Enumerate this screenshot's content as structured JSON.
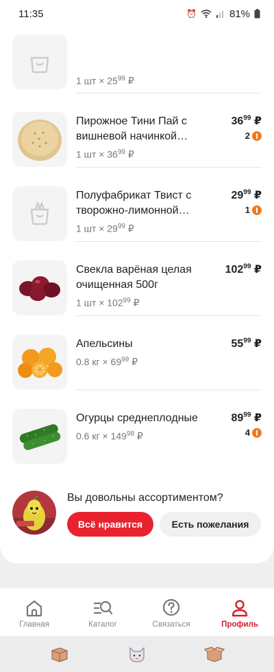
{
  "status": {
    "time": "11:35",
    "battery": "81%",
    "icons": [
      "alarm-icon",
      "wifi-icon",
      "signal-icon",
      "battery-icon"
    ]
  },
  "header": {
    "back_icon": "arrow-left-icon"
  },
  "items": [
    {
      "name": "",
      "qty_prefix": "1 шт × 25",
      "qty_kop": "99",
      "qty_suffix": " ₽",
      "price": "",
      "price_kop": "",
      "bonus": "",
      "thumb": "placeholder-bag"
    },
    {
      "name": "Пирожное Тини Пай с вишневой начинкой…",
      "qty_prefix": "1 шт × 36",
      "qty_kop": "99",
      "qty_suffix": " ₽",
      "price": "36",
      "price_kop": "99",
      "currency": " ₽",
      "bonus": "2",
      "thumb": "pie"
    },
    {
      "name": "Полуфабрикат Твист с творожно-лимонной…",
      "qty_prefix": "1 шт × 29",
      "qty_kop": "99",
      "qty_suffix": " ₽",
      "price": "29",
      "price_kop": "99",
      "currency": " ₽",
      "bonus": "1",
      "thumb": "placeholder-bag"
    },
    {
      "name": "Свекла варёная целая очищенная 500г",
      "qty_prefix": "1 шт × 102",
      "qty_kop": "99",
      "qty_suffix": " ₽",
      "price": "102",
      "price_kop": "99",
      "currency": " ₽",
      "bonus": "",
      "thumb": "beets"
    },
    {
      "name": "Апельсины",
      "qty_prefix": "0.8 кг × 69",
      "qty_kop": "99",
      "qty_suffix": " ₽",
      "price": "55",
      "price_kop": "99",
      "currency": " ₽",
      "bonus": "",
      "thumb": "oranges"
    },
    {
      "name": "Огурцы среднеплодные",
      "qty_prefix": "0.6 кг × 149",
      "qty_kop": "98",
      "qty_suffix": " ₽",
      "price": "89",
      "price_kop": "99",
      "currency": " ₽",
      "bonus": "4",
      "thumb": "cucumbers"
    }
  ],
  "survey": {
    "question": "Вы довольны ассортиментом?",
    "like_label": "Всё нравится",
    "wish_label": "Есть пожелания"
  },
  "tabs": [
    {
      "label": "Главная",
      "icon": "home-icon",
      "active": false
    },
    {
      "label": "Каталог",
      "icon": "catalog-search-icon",
      "active": false
    },
    {
      "label": "Связаться",
      "icon": "help-chat-icon",
      "active": false
    },
    {
      "label": "Профиль",
      "icon": "profile-icon",
      "active": true
    }
  ],
  "colors": {
    "accent": "#e8232f",
    "bonus": "#f07a1e"
  }
}
